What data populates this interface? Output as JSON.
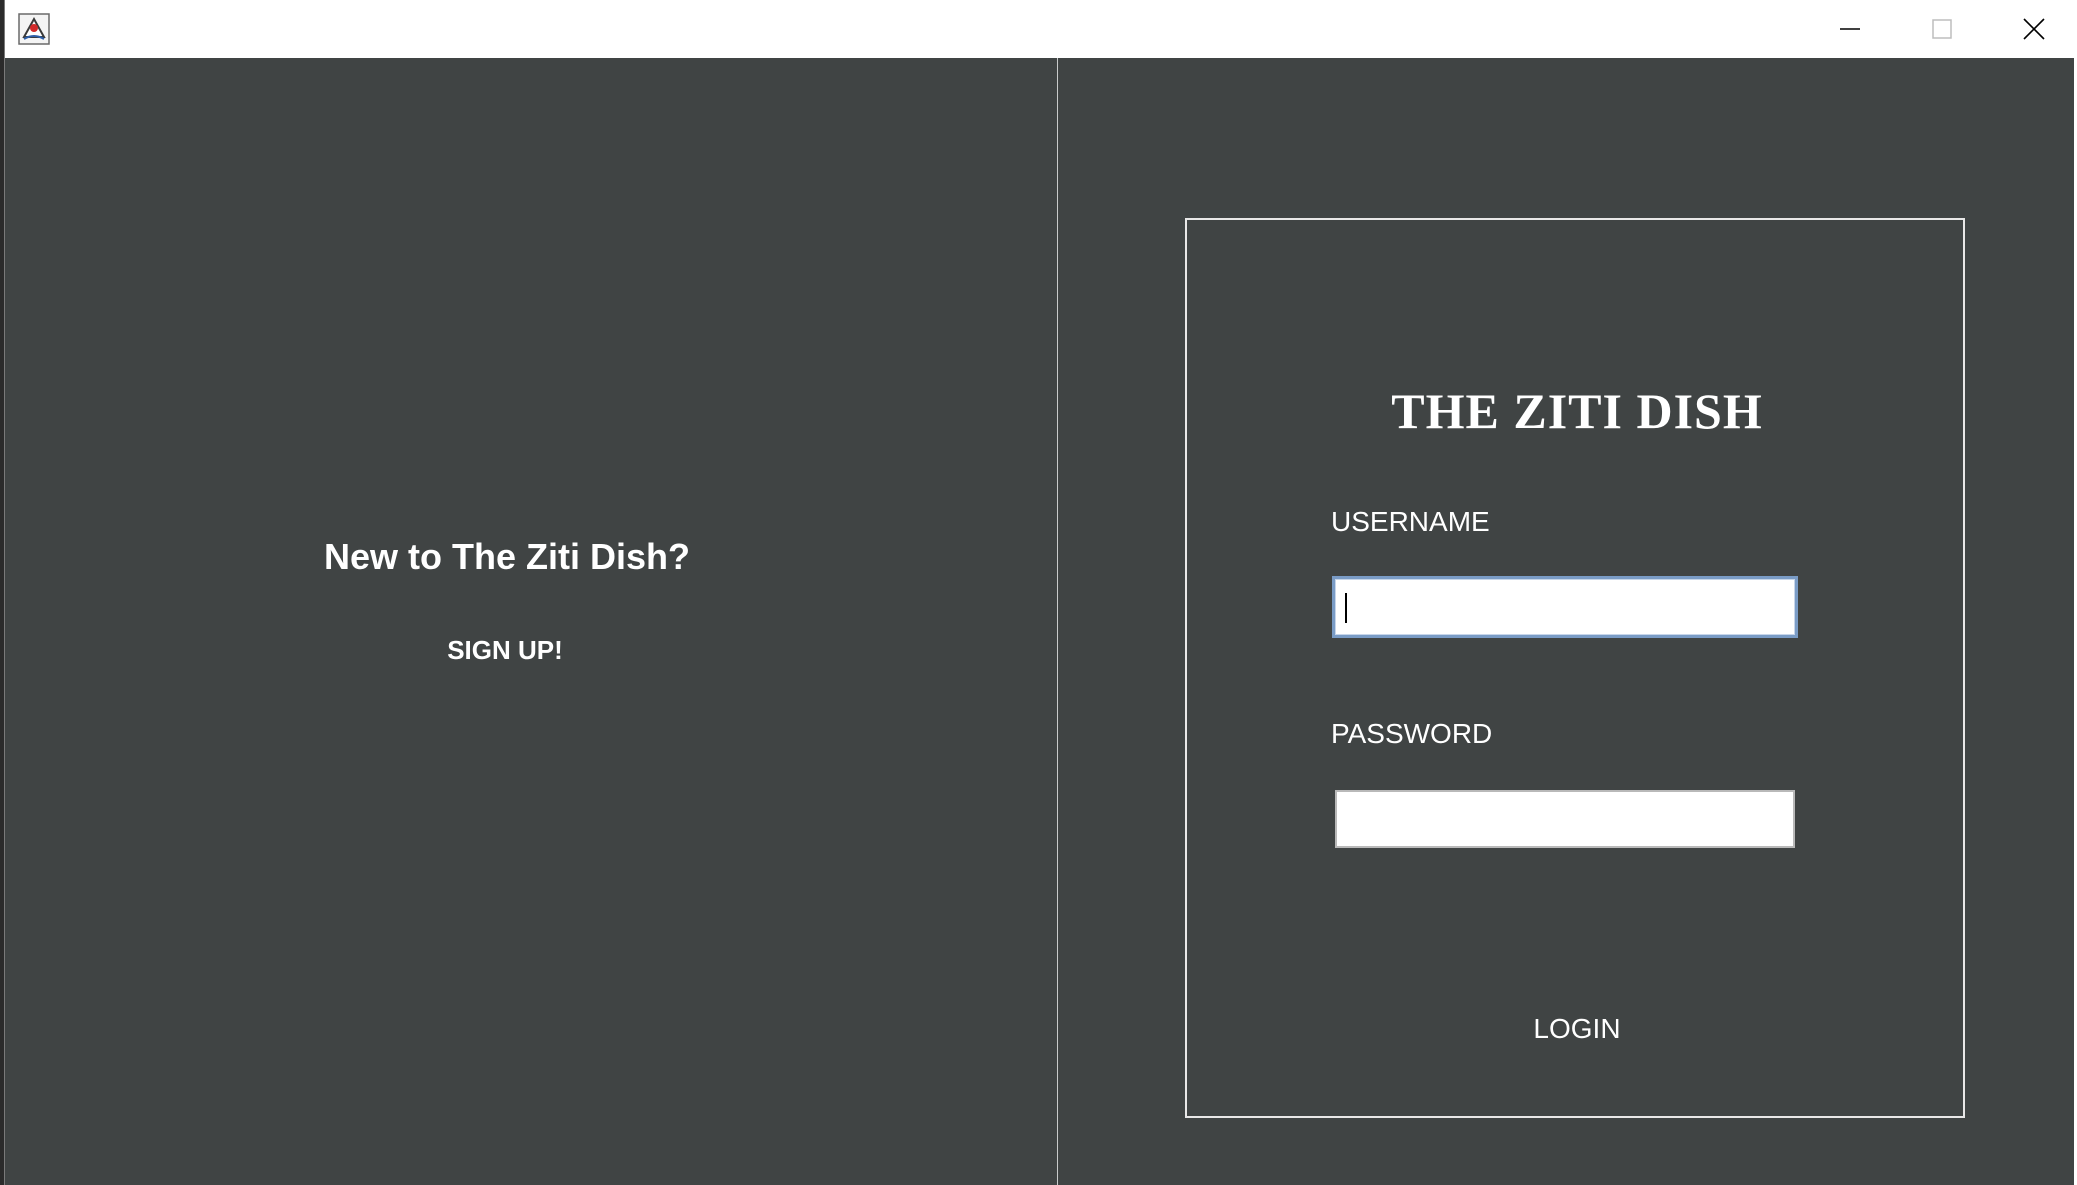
{
  "window": {
    "title": "",
    "icon": "java-app-icon",
    "controls": [
      "minimize-icon",
      "maximize-icon",
      "close-icon"
    ]
  },
  "left_panel": {
    "prompt": "New to The Ziti Dish?",
    "signup_label": "SIGN UP!"
  },
  "login": {
    "brand": "THE ZITI DISH",
    "username_label": "USERNAME",
    "username_value": "",
    "password_label": "PASSWORD",
    "password_value": "",
    "login_label": "LOGIN"
  },
  "colors": {
    "background": "#404444",
    "text": "#ffffff",
    "focus_border": "#7a9cc6"
  }
}
